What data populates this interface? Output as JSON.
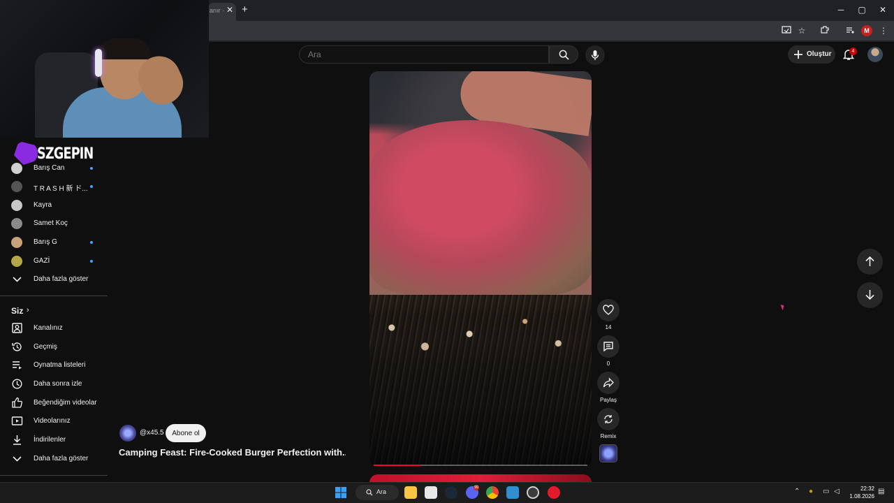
{
  "browser": {
    "tab_title": "anır ·",
    "tab_close": "✕",
    "new_tab": "+",
    "window_controls": [
      "─",
      "▢",
      "✕"
    ],
    "profile_initial": "M"
  },
  "header": {
    "search_placeholder": "Ara",
    "create_label": "Oluştur",
    "notification_count": "4"
  },
  "overlay": {
    "streamer_logo_text": "SZGEPIN"
  },
  "sidebar": {
    "subscriptions": [
      {
        "label": "Barış Can",
        "new": true,
        "color": "#d0d0d0"
      },
      {
        "label": "T R A S H 新 ド...",
        "new": true,
        "color": "#555555"
      },
      {
        "label": "Kayra",
        "new": false,
        "color": "#c8c8c8"
      },
      {
        "label": "Samet Koç",
        "new": false,
        "color": "#8a8a8a"
      },
      {
        "label": "Barış G",
        "new": true,
        "color": "#c9a27a"
      },
      {
        "label": "GAZİ",
        "new": true,
        "color": "#b5a64a"
      }
    ],
    "show_more_1": "Daha fazla göster",
    "you_section": "Siz",
    "you_items": [
      {
        "label": "Kanalınız",
        "icon": "channel-icon"
      },
      {
        "label": "Geçmiş",
        "icon": "history-icon"
      },
      {
        "label": "Oynatma listeleri",
        "icon": "playlists-icon"
      },
      {
        "label": "Daha sonra izle",
        "icon": "watch-later-icon"
      },
      {
        "label": "Beğendiğim videolar",
        "icon": "liked-icon"
      },
      {
        "label": "Videolarınız",
        "icon": "your-videos-icon"
      },
      {
        "label": "İndirilenler",
        "icon": "downloads-icon"
      }
    ],
    "show_more_2": "Daha fazla göster"
  },
  "short": {
    "channel_handle": "@x45.5",
    "subscribe_label": "Abone ol",
    "title": "Camping Feast: Fire-Cooked Burger Perfection with...",
    "likes": "14",
    "comments": "0",
    "share_label": "Paylaş",
    "remix_label": "Remix",
    "progress": 0.22
  },
  "taskbar": {
    "search_label": "Ara",
    "time": "22:32",
    "date": "1.08.2026",
    "discord_badge": "99"
  }
}
